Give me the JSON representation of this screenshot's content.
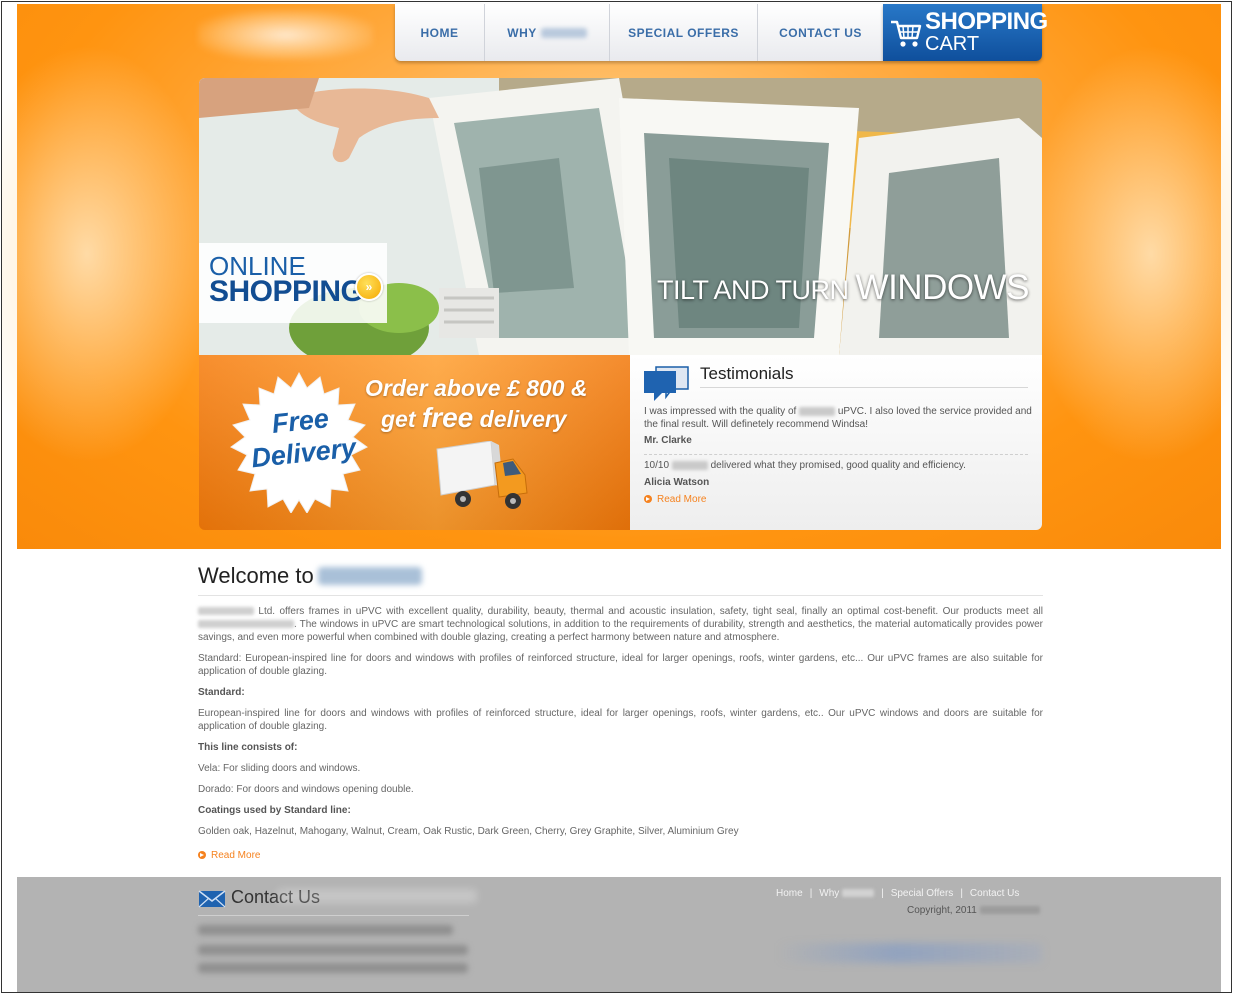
{
  "nav": {
    "home": "HOME",
    "why": "WHY",
    "special_offers": "SPECIAL OFFERS",
    "contact_us": "CONTACT US"
  },
  "cart": {
    "line1": "SHOPPING",
    "line2": "CART"
  },
  "hero": {
    "online_line1": "ONLINE",
    "online_line2": "SHOPPING",
    "arrow_glyph": "»",
    "tilt_small": "TILT AND TURN",
    "tilt_big": "WINDOWS"
  },
  "delivery": {
    "badge_line1": "Free",
    "badge_line2": "Delivery",
    "order_line1": "Order above £ 800 &",
    "order_line2_prefix": "get",
    "order_line2_free": "free",
    "order_line2_suffix": "delivery"
  },
  "testimonials": {
    "title": "Testimonials",
    "quote1_a": "I was impressed with the quality of",
    "quote1_b": "uPVC. I also loved the service provided and the final result. Will definetely recommend Windsa!",
    "author1": "Mr. Clarke",
    "quote2_a": "10/10",
    "quote2_b": "delivered what they promised, good quality and efficiency.",
    "author2": "Alicia Watson",
    "read_more": "Read More"
  },
  "welcome": {
    "title": "Welcome to",
    "p1_a": "Ltd. offers frames in uPVC with excellent quality, durability, beauty, thermal and acoustic insulation, safety, tight seal, finally an optimal cost-benefit. Our products meet all",
    "p1_b": ". The windows in uPVC are smart technological solutions, in addition to the requirements of durability, strength and aesthetics, the material automatically provides power savings, and even more powerful when combined with double glazing, creating a perfect harmony between nature and atmosphere.",
    "p2": "Standard: European-inspired line for doors and windows with profiles of reinforced structure, ideal for larger openings, roofs, winter gardens, etc... Our uPVC frames are also suitable for application of double glazing.",
    "h_standard": "Standard:",
    "p3": "European-inspired line for doors and windows with profiles of reinforced structure, ideal for larger openings, roofs, winter gardens, etc.. Our uPVC windows and doors are suitable for application of double glazing.",
    "h_line": "This line consists of:",
    "p4": "Vela: For sliding doors and windows.",
    "p5": "Dorado: For doors and windows opening double.",
    "h_coatings": "Coatings used by Standard line:",
    "p6": "Golden oak, Hazelnut, Mahogany, Walnut, Cream, Oak Rustic, Dark Green, Cherry, Grey Graphite, Silver, Aluminium Grey",
    "read_more": "Read More"
  },
  "footer": {
    "contact_title": "Contact Us",
    "link_home": "Home",
    "link_why": "Why",
    "link_offers": "Special Offers",
    "link_contact": "Contact Us",
    "separator": "|",
    "copyright": "Copyright, 2011"
  },
  "colors": {
    "orange": "#ff9410",
    "nav_blue": "#3a6da8",
    "cart_blue": "#1a62b0",
    "link_orange": "#f5821f",
    "footer_grey": "#b3b3b3"
  }
}
